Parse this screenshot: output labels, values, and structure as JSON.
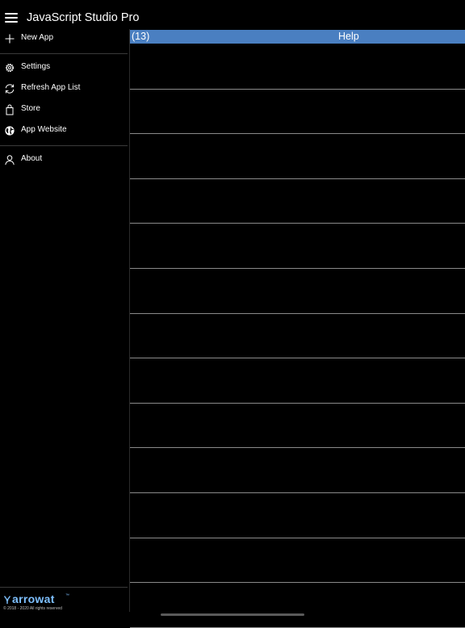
{
  "app": {
    "title": "JavaScript Studio Pro"
  },
  "sidebar": {
    "items": [
      {
        "label": "New App",
        "icon": "plus-icon"
      },
      {
        "label": "Settings",
        "icon": "gear-icon"
      },
      {
        "label": "Refresh App List",
        "icon": "refresh-icon"
      },
      {
        "label": "Store",
        "icon": "shopping-bag-icon"
      },
      {
        "label": "App Website",
        "icon": "globe-icon"
      },
      {
        "label": "About",
        "icon": "person-icon"
      }
    ],
    "brand": {
      "name": "arrowat",
      "tm": "™",
      "copyright": "© 2018 - 2020 All rights reserved"
    }
  },
  "main": {
    "count": "(13)",
    "help_label": "Help",
    "row_count": 13
  },
  "colors": {
    "accent": "#4a7fc1",
    "background": "#000000",
    "brand": "#7ec0ff"
  }
}
